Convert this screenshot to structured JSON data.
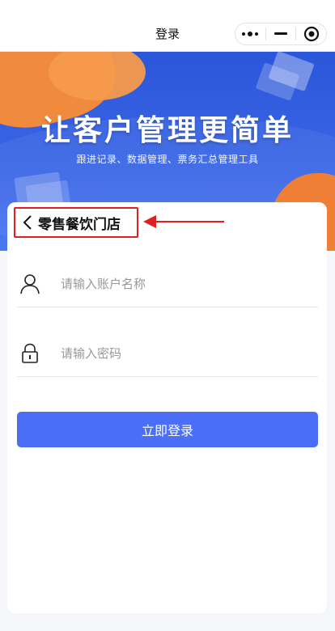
{
  "navbar": {
    "title": "登录"
  },
  "banner": {
    "headline": "让客户管理更简单",
    "subline": "跟进记录、数据管理、票务汇总管理工具"
  },
  "store": {
    "name": "零售餐饮门店"
  },
  "form": {
    "account_placeholder": "请输入账户名称",
    "password_placeholder": "请输入密码",
    "login_label": "立即登录"
  },
  "colors": {
    "primary": "#4a6ef5",
    "banner_blue": "#3a66e6",
    "accent_orange": "#f08a3d",
    "highlight_red": "#e02020"
  },
  "icons": {
    "back": "chevron-left-icon",
    "account": "user-icon",
    "password": "lock-icon",
    "more": "more-dots-icon",
    "minimize": "minimize-icon",
    "close": "target-circle-icon"
  }
}
